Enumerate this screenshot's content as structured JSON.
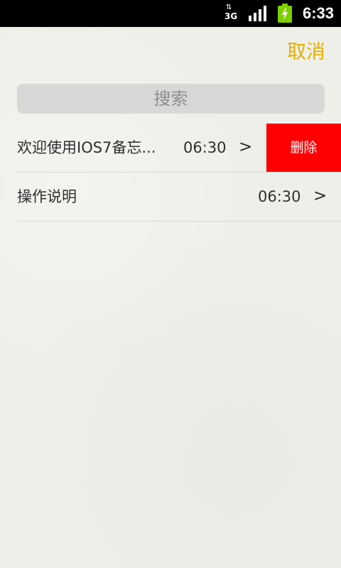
{
  "status_bar": {
    "network": "3G",
    "network_icon": "network-3g-icon",
    "signal_icon": "signal-bars-icon",
    "battery_icon": "battery-charging-icon",
    "time": "6:33"
  },
  "header": {
    "cancel_label": "取消"
  },
  "search": {
    "placeholder": "搜索"
  },
  "notes": [
    {
      "title": "欢迎使用IOS7备忘...",
      "time": "06:30",
      "chevron": ">",
      "delete_label": "删除"
    },
    {
      "title": "操作说明",
      "time": "06:30",
      "chevron": ">"
    }
  ],
  "colors": {
    "accent": "#e5b000",
    "delete": "#ff0000",
    "background": "#efefea",
    "search_bg": "#d8d8d6"
  }
}
